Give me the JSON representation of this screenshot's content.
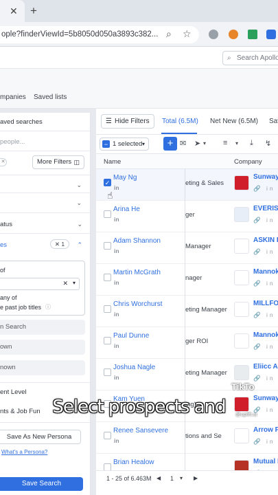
{
  "browser": {
    "close_tab_glyph": "✕",
    "new_tab_glyph": "+",
    "url": "ople?finderViewId=5b8050d050a3893c382..."
  },
  "appbar": {
    "search_placeholder": "Search Apollo"
  },
  "subnav": {
    "tab_companies": "mpanies",
    "tab_saved_lists": "Saved lists"
  },
  "left_panel": {
    "saved_searches": "aved searches",
    "people_placeholder": "people...",
    "more_filters": "More Filters",
    "status_label": "atus",
    "job_titles_section": "es",
    "job_titles_badge": "✕ 1",
    "is_any_of": "of",
    "include_any_of": "any of",
    "past_job_titles": "e past job titles",
    "plain_search": "n Search",
    "known": "own",
    "unknown": "nown",
    "seniority": "ent Level",
    "departments": "nts & Job Fun",
    "save_persona": "Save As New Persona",
    "what_is_persona": "What's a Persona?",
    "save_search": "Save Search"
  },
  "toolbar": {
    "hide_filters": "Hide Filters",
    "tab_total": "Total (6.5M)",
    "tab_net_new": "Net New (6.5M)",
    "tab_saved": "Sav",
    "selected_count": "1 selected",
    "plus": "+"
  },
  "columns": {
    "name": "Name",
    "company": "Company"
  },
  "rows": [
    {
      "name": "May Ng",
      "title": "eting & Sales",
      "company": "Sunway",
      "logo_color": "#d01f2a",
      "selected": true
    },
    {
      "name": "Arina He",
      "title": "ger",
      "company": "EVERIS",
      "logo_color": "#e8eef7",
      "selected": false
    },
    {
      "name": "Adam Shannon",
      "title": "Manager",
      "company": "ASKIN P",
      "logo_color": "#ffffff",
      "selected": false
    },
    {
      "name": "Martin McGrath",
      "title": "nager",
      "company": "Mannok",
      "logo_color": "#ffffff",
      "selected": false
    },
    {
      "name": "Chris Worchurst",
      "title": "eting Manager",
      "company": "MILLFO",
      "logo_color": "#ffffff",
      "selected": false
    },
    {
      "name": "Paul Dunne",
      "title": "ger ROI",
      "company": "Mannok",
      "logo_color": "#ffffff",
      "selected": false
    },
    {
      "name": "Joshua Nagle",
      "title": "eting Manager",
      "company": "Eliicc Am",
      "logo_color": "#e9ecef",
      "selected": false
    },
    {
      "name": "Kam Yuen",
      "title": "ing)",
      "company": "Sunway",
      "logo_color": "#d01f2a",
      "selected": false
    },
    {
      "name": "Renee Sansevere",
      "title": "tions and Se",
      "company": "Arrow F",
      "logo_color": "#ffffff",
      "selected": false
    },
    {
      "name": "Brian Healow",
      "title": "",
      "company": "Mutual I",
      "logo_color": "#b53224",
      "selected": false
    }
  ],
  "linkedin_glyph": "in",
  "company_icons": "🔗 in f",
  "pager": {
    "range": "1 - 25 of 6.463M",
    "page": "1"
  },
  "caption": "Select prospects and",
  "watermark": {
    "brand": "TikTo",
    "handle": "@uplift.ai"
  },
  "colors": {
    "accent": "#2f6fe0",
    "panel": "#ffffff",
    "background": "#e7e9ee"
  }
}
